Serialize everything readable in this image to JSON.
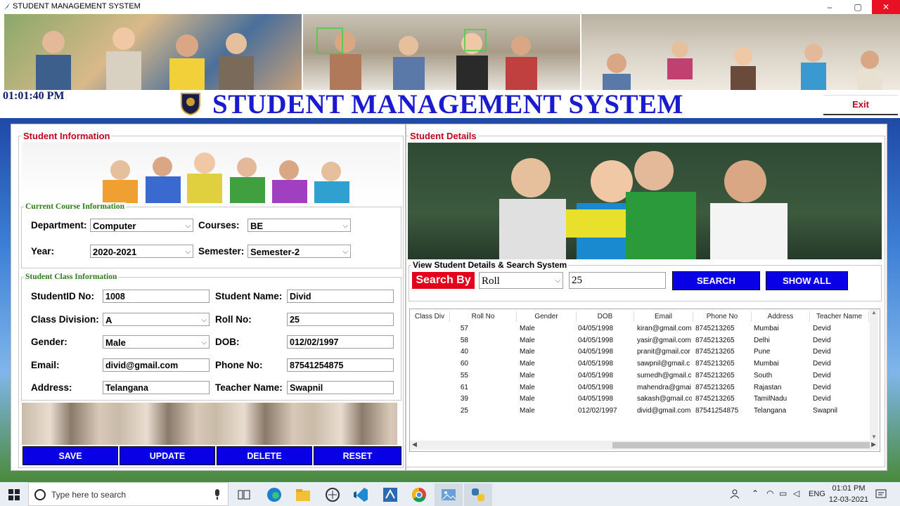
{
  "window": {
    "title": "STUDENT MANAGEMENT SYSTEM",
    "min": "–",
    "max": "▢",
    "close": "✕"
  },
  "header": {
    "clock": "01:01:40 PM",
    "title": "STUDENT MANAGEMENT SYSTEM",
    "exit_label": "Exit"
  },
  "left": {
    "legend": "Student Information",
    "course": {
      "legend": "Current Course Information",
      "department_label": "Department:",
      "department_value": "Computer",
      "courses_label": "Courses:",
      "courses_value": "BE",
      "year_label": "Year:",
      "year_value": "2020-2021",
      "semester_label": "Semester:",
      "semester_value": "Semester-2"
    },
    "class": {
      "legend": "Student Class Information",
      "studentid_label": "StudentID No:",
      "studentid_value": "1008",
      "name_label": "Student Name:",
      "name_value": "Divid",
      "division_label": "Class Division:",
      "division_value": "A",
      "roll_label": "Roll No:",
      "roll_value": "25",
      "gender_label": "Gender:",
      "gender_value": "Male",
      "dob_label": "DOB:",
      "dob_value": "012/02/1997",
      "email_label": "Email:",
      "email_value": "divid@gmail.com",
      "phone_label": "Phone No:",
      "phone_value": "87541254875",
      "address_label": "Address:",
      "address_value": "Telangana",
      "teacher_label": "Teacher Name:",
      "teacher_value": "Swapnil"
    },
    "buttons": {
      "save": "SAVE",
      "update": "UPDATE",
      "delete": "DELETE",
      "reset": "RESET"
    }
  },
  "right": {
    "legend": "Student Details",
    "search": {
      "legend": "View Student Details & Search System",
      "search_by_label": "Search By",
      "search_by_value": "Roll",
      "search_text": "25",
      "search_button": "SEARCH",
      "show_all_button": "SHOW ALL"
    },
    "table": {
      "columns": [
        "Class Div",
        "Roll No",
        "Gender",
        "DOB",
        "Email",
        "Phone No",
        "Address",
        "Teacher Name"
      ],
      "rows": [
        [
          "",
          "57",
          "Male",
          "04/05/1998",
          "kiran@gmail.com",
          "8745213265",
          "Mumbai",
          "Devid"
        ],
        [
          "",
          "58",
          "Male",
          "04/05/1998",
          "yasir@gmail.com",
          "8745213265",
          "Delhi",
          "Devid"
        ],
        [
          "",
          "40",
          "Male",
          "04/05/1998",
          "pranit@gmail.cor",
          "8745213265",
          "Pune",
          "Devid"
        ],
        [
          "",
          "60",
          "Male",
          "04/05/1998",
          "sawpnil@gmail.c",
          "8745213265",
          "Mumbai",
          "Devid"
        ],
        [
          "",
          "55",
          "Male",
          "04/05/1998",
          "sumedh@gmail.c",
          "8745213265",
          "South",
          "Devid"
        ],
        [
          "",
          "61",
          "Male",
          "04/05/1998",
          "mahendra@gmai",
          "8745213265",
          "Rajastan",
          "Devid"
        ],
        [
          "",
          "39",
          "Male",
          "04/05/1998",
          "sakash@gmail.co",
          "8745213265",
          "TamilNadu",
          "Devid"
        ],
        [
          "",
          "25",
          "Male",
          "012/02/1997",
          "divid@gmail.com",
          "87541254875",
          "Telangana",
          "Swapnil"
        ]
      ]
    }
  },
  "taskbar": {
    "search_placeholder": "Type here to search",
    "time": "01:01 PM",
    "date": "12-03-2021",
    "lang": "ENG"
  },
  "colors": {
    "title_blue": "#1a1ad0",
    "legend_red": "#c0001a",
    "sublegend_green": "#2e7a1c",
    "button_blue": "#0a00e6",
    "search_by_red": "#e3001b"
  }
}
